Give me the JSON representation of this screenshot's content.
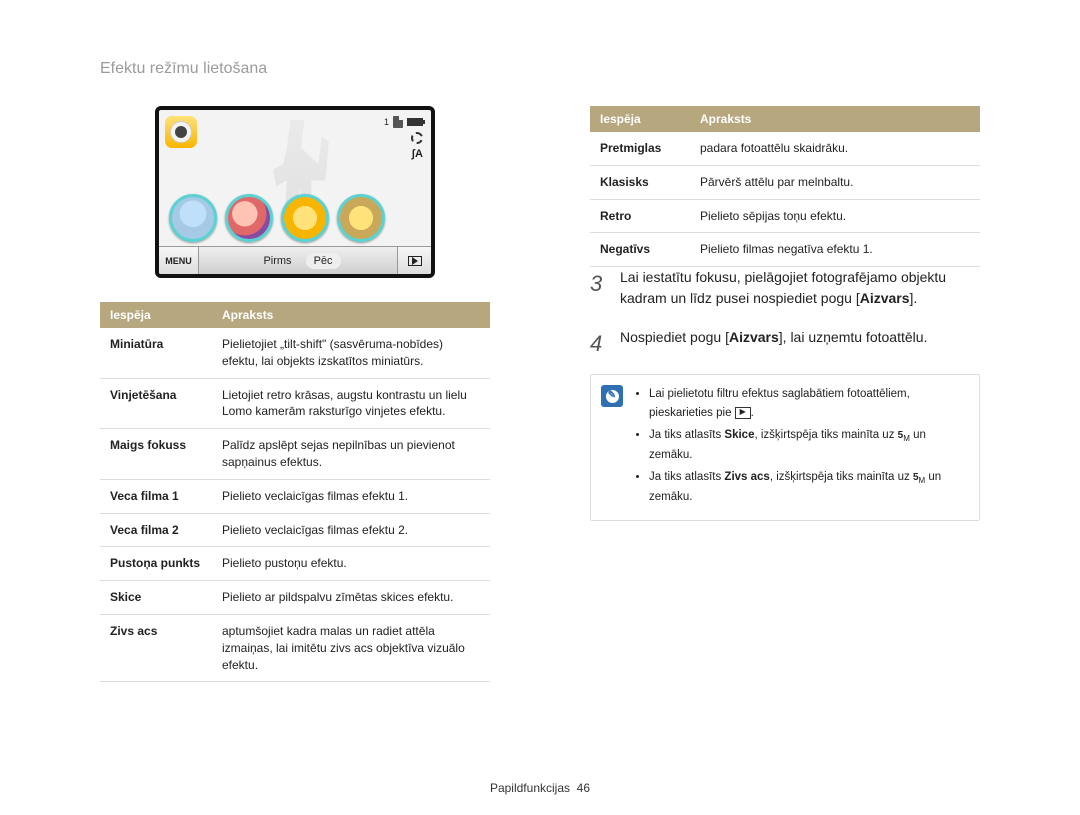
{
  "page_title": "Efektu režīmu lietošana",
  "camera": {
    "count": "1",
    "menu": "MENU",
    "before": "Pirms",
    "after": "Pēc",
    "flash": "ʃA"
  },
  "left_table": {
    "headers": {
      "option": "Iespēja",
      "desc": "Apraksts"
    },
    "rows": [
      {
        "k": "Miniatūra",
        "v": "Pielietojiet „tilt-shift\" (sasvēruma-nobīdes) efektu, lai objekts izskatītos miniatūrs."
      },
      {
        "k": "Vinjetēšana",
        "v": "Lietojiet retro krāsas, augstu kontrastu un lielu Lomo kamerām raksturīgo vinjetes efektu."
      },
      {
        "k": "Maigs fokuss",
        "v": "Palīdz apslēpt sejas nepilnības un pievienot sapņainus efektus."
      },
      {
        "k": "Veca filma 1",
        "v": "Pielieto veclaicīgas filmas efektu 1."
      },
      {
        "k": "Veca filma 2",
        "v": "Pielieto veclaicīgas filmas efektu 2."
      },
      {
        "k": "Pustoņa punkts",
        "v": "Pielieto pustoņu efektu."
      },
      {
        "k": "Skice",
        "v": "Pielieto ar pildspalvu zīmētas skices efektu."
      },
      {
        "k": "Zivs acs",
        "v": "aptumšojiet kadra malas un radiet attēla izmaiņas, lai imitētu zivs acs objektīva vizuālo efektu."
      }
    ]
  },
  "right_table": {
    "headers": {
      "option": "Iespēja",
      "desc": "Apraksts"
    },
    "rows": [
      {
        "k": "Pretmiglas",
        "v": "padara fotoattēlu skaidrāku."
      },
      {
        "k": "Klasisks",
        "v": "Pārvērš attēlu par melnbaltu."
      },
      {
        "k": "Retro",
        "v": "Pielieto sēpijas toņu efektu."
      },
      {
        "k": "Negatīvs",
        "v": "Pielieto filmas negatīva efektu 1."
      }
    ]
  },
  "steps": {
    "3": {
      "num": "3",
      "text_a": "Lai iestatītu fokusu, pielāgojiet fotografējamo objektu kadram un līdz pusei nospiediet pogu [",
      "bold_a": "Aizvars",
      "text_b": "]."
    },
    "4": {
      "num": "4",
      "text_a": "Nospiediet pogu [",
      "bold_a": "Aizvars",
      "text_b": "], lai uzņemtu fotoattēlu."
    }
  },
  "note": {
    "items": [
      {
        "a": "Lai pielietotu filtru efektus saglabātiem fotoattēliem, pieskarieties pie ",
        "b": "."
      },
      {
        "a": "Ja tiks atlasīts ",
        "strong": "Skice",
        "b": ", izšķirtspēja tiks mainīta uz ",
        "c": " un zemāku."
      },
      {
        "a": "Ja tiks atlasīts ",
        "strong": "Zivs acs",
        "b": ", izšķirtspēja tiks mainīta uz ",
        "c": " un zemāku."
      }
    ]
  },
  "footer": {
    "section": "Papildfunkcijas",
    "page": "46"
  }
}
